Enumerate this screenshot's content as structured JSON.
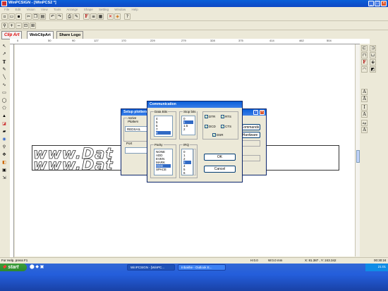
{
  "app": {
    "title": "WinPCSIGN - [WinPCS2 *]"
  },
  "menu": [
    "File",
    "Edit",
    "Vision",
    "View",
    "Tools",
    "Arrange",
    "Shape",
    "Setting",
    "Window",
    "Help"
  ],
  "tabs": {
    "clipart": "Clip Art",
    "webclipart": "WebClipArt",
    "share_logo": "Share Logo"
  },
  "ruler_h": [
    "0",
    "50",
    "90",
    "127",
    "170",
    "229",
    "279",
    "328",
    "375",
    "414",
    "462",
    "504"
  ],
  "canvas_text": {
    "line1": "www.Dat",
    "line2": "www.Dat"
  },
  "setup_dialog": {
    "title": "Setup plotters",
    "active_plotters_label": "Active Plotters",
    "plotter_value": "REDSAIL RS720",
    "port_label": "Port",
    "commands_button": "Commands",
    "hardware_button": "Hardware"
  },
  "comm_dialog": {
    "title": "Communication",
    "data_bits_label": "Data Bits",
    "data_bits": [
      "4",
      "5",
      "6",
      "7",
      "8"
    ],
    "stop_bits_label": "Stop bits",
    "stop_bits": [
      "0",
      "1",
      "1.5",
      "2"
    ],
    "parity_label": "Parity",
    "parity": [
      "NONE",
      "ADD",
      "EVEN",
      "MARK",
      "ODD",
      "SPACE"
    ],
    "irq_label": "IRQ",
    "irq": [
      "0",
      "1",
      "2",
      "3",
      "4",
      "5",
      "6"
    ],
    "dtr": "DTR",
    "rts": "RTS",
    "dcd": "DCD",
    "cts": "CTS",
    "dsr": "DSR",
    "ok": "OK",
    "cancel": "Cancel"
  },
  "status": {
    "help": "For Help, press F1",
    "h": "H:0.0",
    "w": "W:0.0 mm",
    "coords": "X: 81.387 , Y: 243.342",
    "time": "00:30:24"
  },
  "taskbar": {
    "start": "start",
    "tasks": [
      "WinPCSIGN - [WinPC...",
      "Inbakhe - Outlook E..."
    ],
    "clock": "21:01"
  }
}
